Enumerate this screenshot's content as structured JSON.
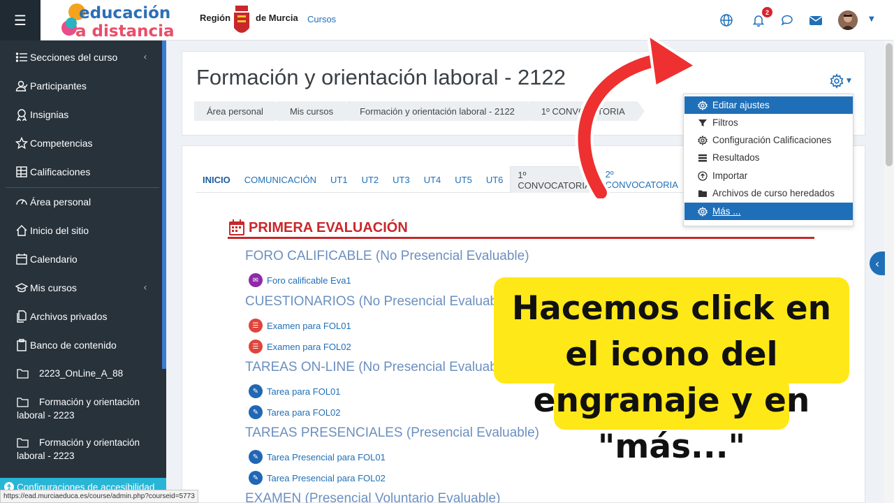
{
  "header": {
    "logo_text_top": "educación",
    "logo_text_bottom": "a distancia",
    "region_label": "Región",
    "murcia_label": "de Murcia",
    "courses_link": "Cursos",
    "notification_count": "2"
  },
  "sidebar": {
    "items": [
      {
        "label": "Secciones del curso",
        "icon": "list-icon"
      },
      {
        "label": "Participantes",
        "icon": "users-icon"
      },
      {
        "label": "Insignias",
        "icon": "badge-icon"
      },
      {
        "label": "Competencias",
        "icon": "star-icon"
      },
      {
        "label": "Calificaciones",
        "icon": "grades-icon"
      },
      {
        "label": "Área personal",
        "icon": "dashboard-icon"
      },
      {
        "label": "Inicio del sitio",
        "icon": "home-icon"
      },
      {
        "label": "Calendario",
        "icon": "calendar-icon"
      },
      {
        "label": "Mis cursos",
        "icon": "graduation-icon"
      },
      {
        "label": "Archivos privados",
        "icon": "files-icon"
      },
      {
        "label": "Banco de contenido",
        "icon": "clipboard-icon"
      }
    ],
    "folders": [
      "2223_OnLine_A_88",
      "Formación y orientación laboral - 2223",
      "Formación y orientación laboral - 2223"
    ],
    "accessibility": "Configuraciones de accesibilidad"
  },
  "course": {
    "title": "Formación y orientación laboral - 2122",
    "breadcrumbs": [
      "Área personal",
      "Mis cursos",
      "Formación y orientación laboral - 2122",
      "1º CONVOCATORIA"
    ]
  },
  "tabs": [
    "INICIO",
    "COMUNICACIÓN",
    "UT1",
    "UT2",
    "UT3",
    "UT4",
    "UT5",
    "UT6",
    "1º CONVOCATORIA",
    "2º CONVOCATORIA"
  ],
  "content": {
    "eval_heading": "PRIMERA EVALUACIÓN",
    "sections": [
      {
        "title": "FORO CALIFICABLE (No Presencial Evaluable)",
        "activities": [
          "Foro calificable Eva1"
        ]
      },
      {
        "title": "CUESTIONARIOS (No Presencial Evaluable)",
        "activities": [
          "Examen para FOL01",
          "Examen para FOL02"
        ]
      },
      {
        "title": "TAREAS ON-LINE (No Presencial Evaluable)",
        "activities": [
          "Tarea para FOL01",
          "Tarea para FOL02"
        ]
      },
      {
        "title": "TAREAS PRESENCIALES (Presencial Evaluable)",
        "activities": [
          "Tarea Presencial para FOL01",
          "Tarea Presencial para FOL02"
        ]
      },
      {
        "title": "EXAMEN (Presencial Voluntario Evaluable)",
        "activities": []
      }
    ]
  },
  "dropdown": {
    "items": [
      {
        "label": "Editar ajustes",
        "icon": "gear-icon"
      },
      {
        "label": "Filtros",
        "icon": "filter-icon"
      },
      {
        "label": "Configuración Calificaciones",
        "icon": "gear-icon"
      },
      {
        "label": "Resultados",
        "icon": "list-icon"
      },
      {
        "label": "Importar",
        "icon": "upload-icon"
      },
      {
        "label": "Archivos de curso heredados",
        "icon": "folder-icon"
      },
      {
        "label": "Más ...",
        "icon": "gear-icon"
      }
    ]
  },
  "callout": {
    "text": "Hacemos click en el icono del engranaje y en \"más...\""
  },
  "status_url": "https://ead.murciaeduca.es/course/admin.php?courseid=5773",
  "colors": {
    "sidebar": "#27323b",
    "accent": "#1f6fb8",
    "eval_red": "#c8282b",
    "callout": "#ffe817"
  }
}
